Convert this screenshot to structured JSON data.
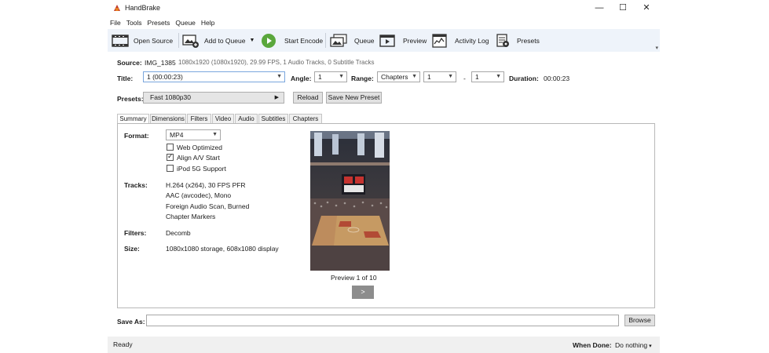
{
  "window": {
    "title": "HandBrake",
    "controls": [
      "—",
      "☐",
      "✕"
    ]
  },
  "menu": [
    "File",
    "Tools",
    "Presets",
    "Queue",
    "Help"
  ],
  "toolbar": {
    "open_source": "Open Source",
    "add_to_queue": "Add to Queue",
    "start_encode": "Start Encode",
    "queue": "Queue",
    "preview": "Preview",
    "activity_log": "Activity Log",
    "presets": "Presets"
  },
  "source": {
    "label": "Source:",
    "name": "IMG_1385",
    "info": "1080x1920 (1080x1920), 29.99 FPS, 1 Audio Tracks, 0 Subtitle Tracks"
  },
  "title_row": {
    "title_label": "Title:",
    "title_value": "1 (00:00:23)",
    "angle_label": "Angle:",
    "angle_value": "1",
    "range_label": "Range:",
    "range_type": "Chapters",
    "range_start": "1",
    "range_sep": "-",
    "range_end": "1",
    "duration_label": "Duration:",
    "duration_value": "00:00:23"
  },
  "presets_row": {
    "label": "Presets:",
    "value": "Fast 1080p30",
    "reload": "Reload",
    "save_new": "Save New Preset"
  },
  "tabs": [
    "Summary",
    "Dimensions",
    "Filters",
    "Video",
    "Audio",
    "Subtitles",
    "Chapters"
  ],
  "summary": {
    "format_label": "Format:",
    "format_value": "MP4",
    "options": [
      {
        "label": "Web Optimized",
        "checked": false
      },
      {
        "label": "Align A/V Start",
        "checked": true
      },
      {
        "label": "iPod 5G Support",
        "checked": false
      }
    ],
    "tracks_label": "Tracks:",
    "tracks": [
      "H.264 (x264), 30 FPS PFR",
      "AAC (avcodec), Mono",
      "Foreign Audio Scan, Burned",
      "Chapter Markers"
    ],
    "filters_label": "Filters:",
    "filters_value": "Decomb",
    "size_label": "Size:",
    "size_value": "1080x1080 storage, 608x1080 display",
    "preview_caption": "Preview 1 of 10",
    "next_label": ">"
  },
  "save_as": {
    "label": "Save As:",
    "value": "",
    "browse": "Browse"
  },
  "status": {
    "text": "Ready",
    "when_done_label": "When Done:",
    "when_done_value": "Do nothing"
  }
}
